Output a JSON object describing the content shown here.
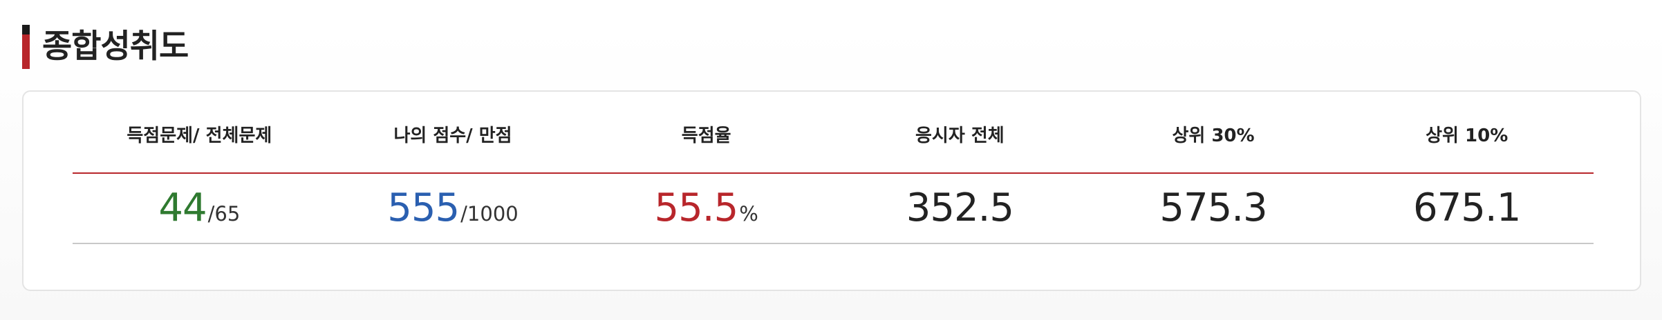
{
  "section": {
    "title": "종합성취도"
  },
  "table": {
    "headers": [
      "득점문제/ 전체문제",
      "나의 점수/ 만점",
      "득점율",
      "응시자 전체",
      "상위 30%",
      "상위 10%"
    ],
    "values": {
      "solved": "44",
      "total_questions": "/65",
      "my_score": "555",
      "max_score": "/1000",
      "rate": "55.5",
      "rate_unit": "%",
      "all_examinees": "352.5",
      "top30": "575.3",
      "top10": "675.1"
    }
  },
  "colors": {
    "accent_red": "#b8262b",
    "score_green": "#2f7a30",
    "score_blue": "#2a5fb0"
  }
}
